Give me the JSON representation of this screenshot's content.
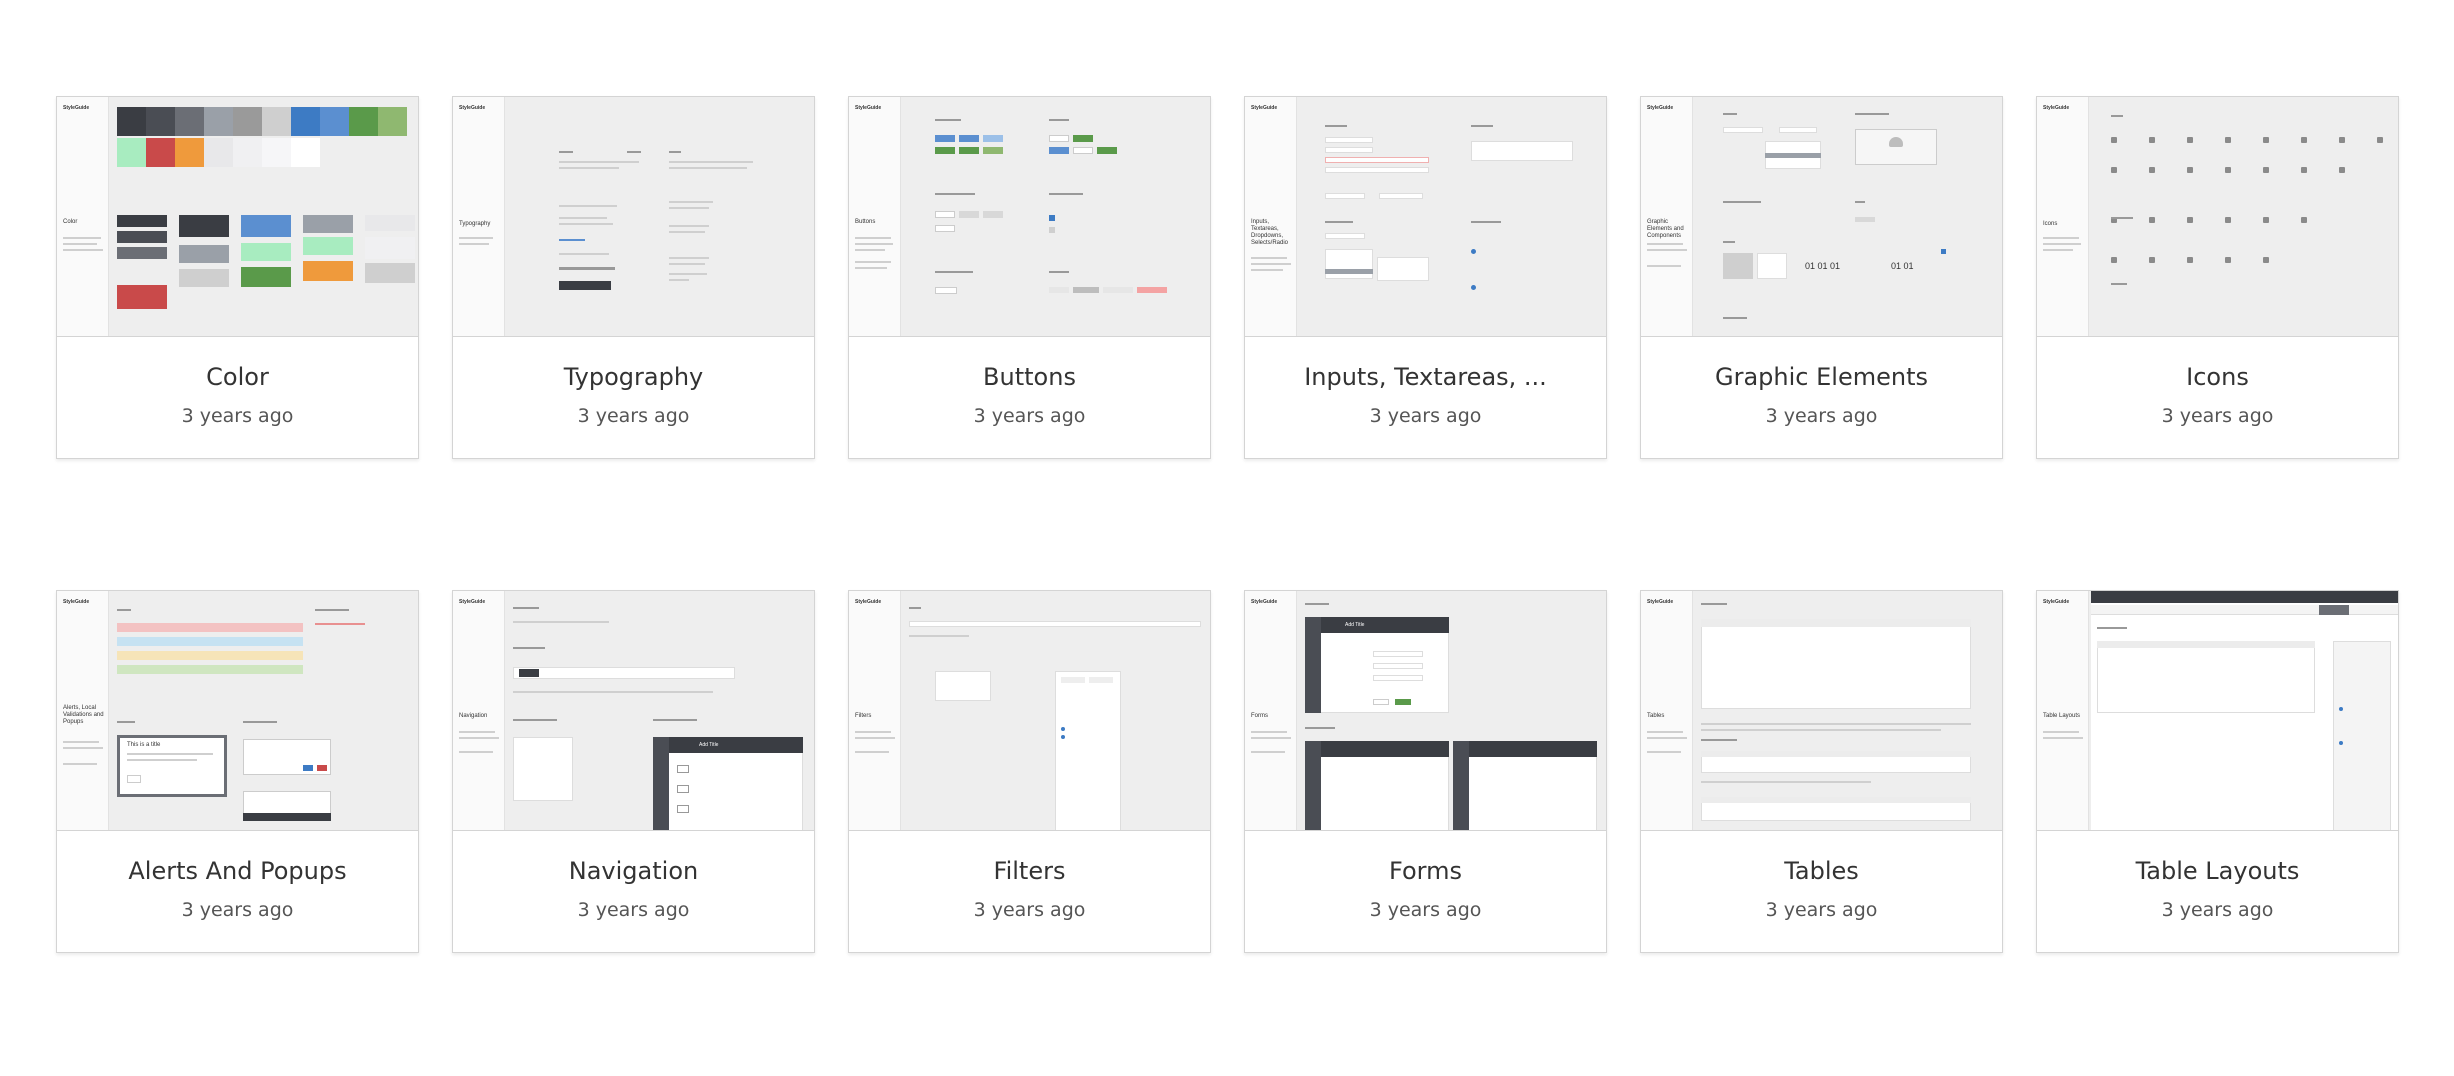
{
  "cards": [
    {
      "title": "Color",
      "date": "3 years ago",
      "section": "Color"
    },
    {
      "title": "Typography",
      "date": "3 years ago",
      "section": "Typography"
    },
    {
      "title": "Buttons",
      "date": "3 years ago",
      "section": "Buttons"
    },
    {
      "title": "Inputs, Textareas, ...",
      "date": "3 years ago",
      "section": "Inputs, Textareas, Dropdowns, Selects/Radio"
    },
    {
      "title": "Graphic Elements",
      "date": "3 years ago",
      "section": "Graphic Elements and Components"
    },
    {
      "title": "Icons",
      "date": "3 years ago",
      "section": "Icons"
    },
    {
      "title": "Alerts And Popups",
      "date": "3 years ago",
      "section": "Alerts, Local Validations and Popups"
    },
    {
      "title": "Navigation",
      "date": "3 years ago",
      "section": "Navigation"
    },
    {
      "title": "Filters",
      "date": "3 years ago",
      "section": "Filters"
    },
    {
      "title": "Forms",
      "date": "3 years ago",
      "section": "Forms"
    },
    {
      "title": "Tables",
      "date": "3 years ago",
      "section": "Tables"
    },
    {
      "title": "Table Layouts",
      "date": "3 years ago",
      "section": "Table Layouts"
    }
  ],
  "thumbnail_brand": "StyleGuide",
  "colors": {
    "swatches_row1": [
      "#3a3d43",
      "#4a4d54",
      "#6b6e75",
      "#9aa0a8",
      "#9a9a9a",
      "#cfcfcf",
      "#3d7bc4",
      "#5b8fd0",
      "#5a9a4a",
      "#8fb870"
    ],
    "swatches_row2": [
      "#a8ecc0",
      "#c94a4a",
      "#ef9a3c",
      "#e8e8ea",
      "#f0f0f2",
      "#f6f6f8",
      "#ffffff"
    ]
  }
}
